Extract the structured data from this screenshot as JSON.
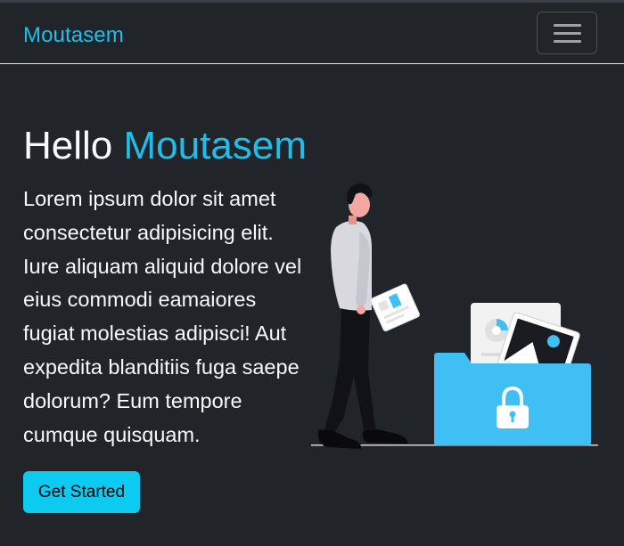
{
  "navbar": {
    "brand": "Moutasem",
    "toggler_icon": "hamburger-menu-icon"
  },
  "hero": {
    "title_prefix": "Hello",
    "title_accent": "Moutasem",
    "paragraph": "Lorem ipsum dolor sit amet consectetur adipisicing elit. Iure aliquam aliquid dolore vel eius commodi eamaiores fugiat molestias adipisci! Aut expedita blanditiis fuga saepe dolorum? Eum tempore cumque quisquam.",
    "cta_label": "Get Started",
    "illustration": "person-with-secure-files-illustration"
  },
  "colors": {
    "background": "#212529",
    "accent": "#1fbde8",
    "button": "#0dcaf0",
    "folder": "#40bff5"
  }
}
